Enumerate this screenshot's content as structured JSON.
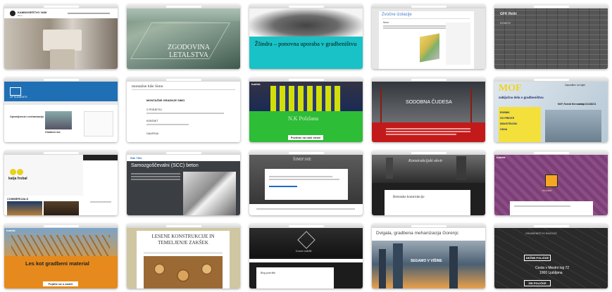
{
  "thumbnails": [
    {
      "title": "",
      "header": "KAMNOSEŠTVO VAM",
      "sub": "d.o.o."
    },
    {
      "title": "ZGODOVINA\nLETALSTVA"
    },
    {
      "title": "Žlindra – ponovna uporaba v gradbeništvu"
    },
    {
      "title": "Zvočne izolacije",
      "sub": "Novo"
    },
    {
      "title": "GFK Relić",
      "sub": "DOMOV"
    },
    {
      "title": "UP ELEMENTS",
      "post": "Opremljenost z mehanizacijo",
      "post2": "Gradbeni kot"
    },
    {
      "title": "montažne hiše Simo",
      "h1": "MONTAŽNE GRADNJE SIMO",
      "h2": "O PODJETJU",
      "h3": "KONTAKT",
      "h4": "GALERIJA"
    },
    {
      "title": "N.K Polzlana",
      "header": "tumblr.",
      "cta": "Pozdrav na naši strani"
    },
    {
      "title": "SODOBNA ČUDESA"
    },
    {
      "title": "MOF",
      "sub": "Zaposlitev na tujini",
      "sub2": "zaključna dela v gradbeništvu",
      "sub3": "MOF, Robnik Bernard s.p.",
      "sub4": "mob: 031348211",
      "bullets": [
        "ROBNIK",
        "GO PRIDITE",
        "INDUSTRIJSKI",
        "OKNA"
      ]
    },
    {
      "title": "katja frobal",
      "sub": "COMMERCIALS"
    },
    {
      "title": "Samozgoščevalni (SCC) beton",
      "header": "Site Title"
    },
    {
      "title": "ŠIMIF.ME"
    },
    {
      "title": "Konstrukcijski okvir",
      "sub": "Betonske konstrukcije"
    },
    {
      "title": "Innobet",
      "header": "tumblr."
    },
    {
      "title": "Les kot gradbeni material",
      "header": "tumblr.",
      "cta": "Pojdite na n.zadeli"
    },
    {
      "title": "LESENE KONSTRUKCIJE IN TEMELJENJE ZAKŠEK"
    },
    {
      "title": "Lesene izdelki",
      "sub": "Blog post title"
    },
    {
      "title": "Dvigala, gradbena mehanizacija Gorenjc",
      "sub": "SEGAMO V VIŠINE"
    },
    {
      "title": "GRADBENIŠTVO RADOVIŠ",
      "btn1": "DEŽNE POLIČKE",
      "btn2": "ZID POLIČKE",
      "addr1": "Cesta v Mestni log 72",
      "addr2": "1000 Ljubljana"
    }
  ],
  "colors": {
    "close": "#ff5f57",
    "min": "#febc2e",
    "max": "#28c840"
  }
}
